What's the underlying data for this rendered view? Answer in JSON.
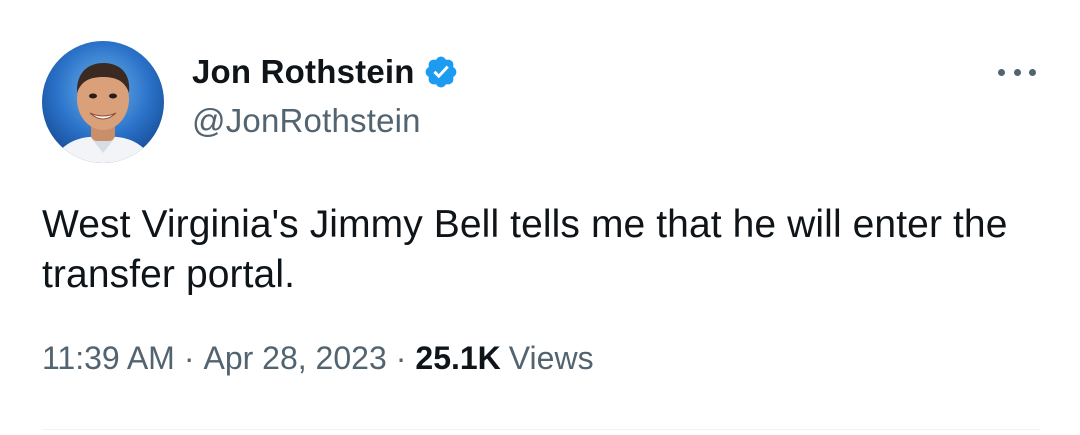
{
  "author": {
    "display_name": "Jon Rothstein",
    "handle": "@JonRothstein",
    "verified": true
  },
  "tweet": {
    "text": "West Virginia's Jimmy Bell tells me that he will enter the transfer portal.",
    "time": "11:39 AM",
    "separator": "·",
    "date": "Apr 28, 2023",
    "views_count": "25.1K",
    "views_label": "Views"
  },
  "icons": {
    "verified": "verified-badge-icon",
    "more": "more-options-icon"
  },
  "colors": {
    "text_primary": "#0f1419",
    "text_secondary": "#536471",
    "verified_blue": "#1d9bf0"
  }
}
